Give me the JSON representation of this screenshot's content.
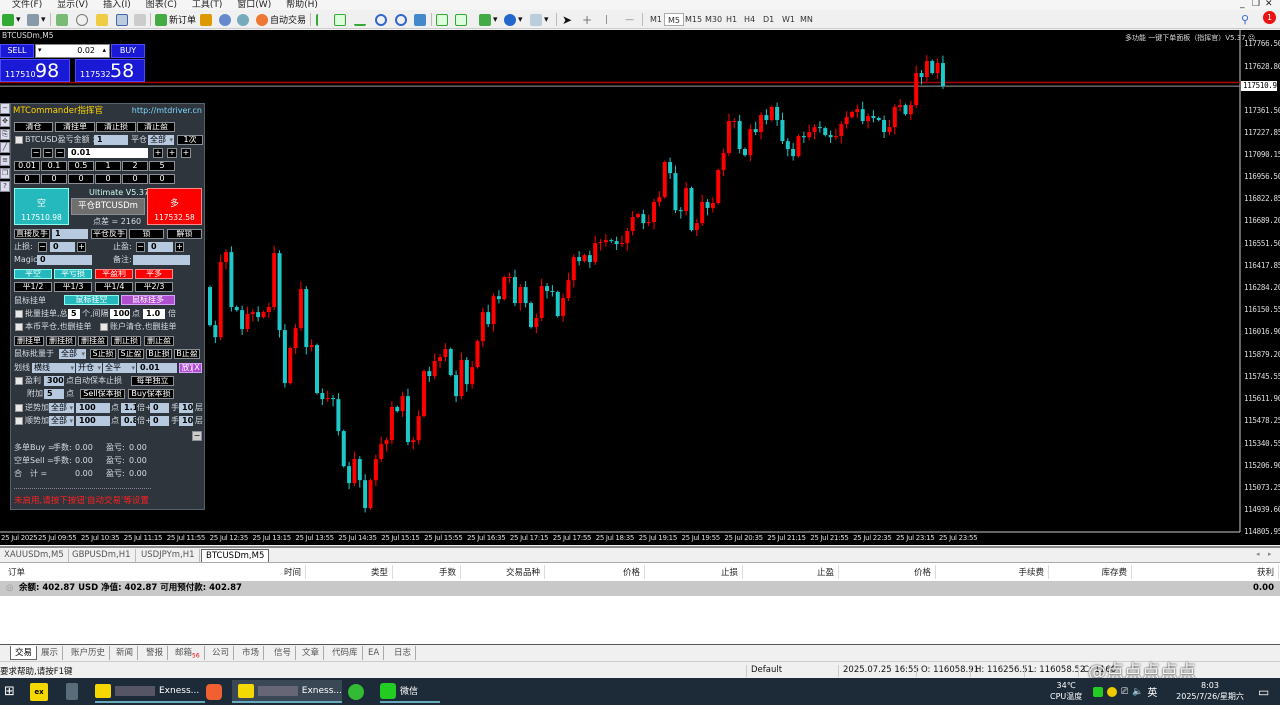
{
  "menu": [
    "文件(F)",
    "显示(V)",
    "插入(I)",
    "图表(C)",
    "工具(T)",
    "窗口(W)",
    "帮助(H)"
  ],
  "toolbar": {
    "new_order": "新订单",
    "auto_trading": "自动交易",
    "timeframes": [
      "M1",
      "M5",
      "M15",
      "M30",
      "H1",
      "H4",
      "D1",
      "W1",
      "MN"
    ],
    "active_tf": "M5",
    "notifications": "1"
  },
  "chart": {
    "title": "BTCUSDm,M5",
    "indicator_label": "多功能 一键下单面板（指挥官）V5.37",
    "bid": "117510.98"
  },
  "oneclick": {
    "sell": "SELL",
    "buy": "BUY",
    "lot": "0.02",
    "sell_big": "117510",
    "sell_pips": "98",
    "buy_big": "117532",
    "buy_pips": "58"
  },
  "panel": {
    "title": "MTCommander指挥官",
    "url": "http://mtdriver.cn",
    "row1": [
      "清仓",
      "清挂单",
      "清止损",
      "清止盈"
    ],
    "pl_label": "BTCUSD盈亏金额 >",
    "pl_value": "1",
    "close_label": "平仓",
    "close_sel": "全部",
    "times": "1次",
    "lot": "0.01",
    "lot_presets": [
      "0.01",
      "0.1",
      "0.5",
      "1",
      "2",
      "5"
    ],
    "zeros": [
      "0",
      "0",
      "0",
      "0",
      "0",
      "0"
    ],
    "sell_label": "空",
    "sell_price": "117510.98",
    "version": "Ultimate V5.37",
    "close_sym": "平仓BTCUSDm",
    "spread": "点差 = 2160",
    "buy_label": "多",
    "buy_price": "117532.58",
    "reverse": "直接反手",
    "reverse_val": "1",
    "close_reverse": "平仓反手",
    "lock": "锁",
    "unlock": "解锁",
    "sl_label": "止损:",
    "sl_val": "0",
    "tp_label": "止盈:",
    "tp_val": "0",
    "magic_label": "Magic:",
    "magic_val": "0",
    "comment_label": "备注:",
    "comment_val": "",
    "close_row": [
      "平空",
      "平亏损",
      "平盈利",
      "平多"
    ],
    "partial_row": [
      "平1/2",
      "平1/3",
      "平1/4",
      "平2/3"
    ],
    "mouse_pending": "鼠标挂单",
    "mouse_sell": "鼠标挂空",
    "mouse_buy": "鼠标挂多",
    "batch_label": "批量挂单,总",
    "batch_count": "5",
    "batch_unit": "个,间隔",
    "batch_gap": "100",
    "batch_pts": "点",
    "batch_mult": "1.0",
    "batch_x": "倍",
    "cb_sym": "本币平仓,也删挂单",
    "cb_acct": "账户清仓,也删挂单",
    "del_row": [
      "删挂单",
      "删挂损",
      "删挂盈",
      "删止损",
      "删止盈"
    ],
    "mouse_batch": "鼠标批量于",
    "mouse_batch_sel": "全部",
    "sb_row": [
      "S止损",
      "S止盈",
      "B止损",
      "B止盈"
    ],
    "line_label": "划线",
    "line_type": "横线",
    "line_open": "开仓",
    "line_close": "全平",
    "line_lot": "0.01",
    "place": "放置",
    "x": "X",
    "profit_label": "盈利",
    "profit_val": "300",
    "profit_text": "点自动保本止损",
    "each": "每单独立",
    "extra_label": "附加",
    "extra_val": "5",
    "extra_pts": "点",
    "sell_be": "Sell保本损",
    "buy_be": "Buy保本损",
    "counter_label": "逆势加",
    "counter_sel": "全部",
    "counter_pts": "100",
    "counter_mult": "1.1",
    "counter_add": "0",
    "counter_layers": "10",
    "trend_label": "顺势加",
    "trend_sel": "全部",
    "trend_pts": "100",
    "trend_mult": "0.8",
    "trend_add": "0",
    "trend_layers": "10",
    "pts": "点",
    "mult": "倍+",
    "hand": "手",
    "layer": "层",
    "buy_sum": "多单Buy =",
    "sell_sum": "空单Sell =",
    "total": "合　计 =",
    "lots_label": "手数:",
    "pl_lbl": "盈亏:",
    "zero": "0.00",
    "warning": "未启用,请按下按钮'自动交易'等设置"
  },
  "chart_data": {
    "type": "candlestick",
    "symbol": "BTCUSDm",
    "timeframe": "M5",
    "open_first": 116291,
    "closes": [
      116060,
      115987,
      116443,
      116503,
      116170,
      116151,
      116036,
      116127,
      116139,
      116109,
      116139,
      116170,
      116497,
      116030,
      115708,
      115921,
      116042,
      116279,
      115927,
      115939,
      115648,
      115611,
      115617,
      115611,
      115417,
      115204,
      115101,
      115247,
      115119,
      114950,
      115119,
      115247,
      115338,
      115362,
      115563,
      115538,
      115629,
      115350,
      115362,
      115508,
      115781,
      115751,
      115842,
      115866,
      115915,
      115757,
      115629,
      115848,
      115702,
      115805,
      115963,
      116139,
      116066,
      116236,
      116218,
      116352,
      116352,
      116194,
      116291,
      116194,
      116048,
      116103,
      116297,
      116267,
      116261,
      116115,
      116224,
      116333,
      116473,
      116449,
      116485,
      116443,
      116558,
      116564,
      116576,
      116570,
      116552,
      116558,
      116631,
      116716,
      116734,
      116679,
      116686,
      116807,
      116837,
      117050,
      116983,
      116758,
      116752,
      116892,
      116637,
      116679,
      116807,
      116771,
      116801,
      117001,
      117104,
      117299,
      117299,
      117129,
      117092,
      117250,
      117232,
      117335,
      117305,
      117384,
      117305,
      117177,
      117129,
      117086,
      117208,
      117201,
      117232,
      117262,
      117256,
      117214,
      117201,
      117208,
      117280,
      117323,
      117353,
      117371,
      117299,
      117329,
      117317,
      117305,
      117232,
      117262,
      117384,
      117396,
      117341,
      117396,
      117590,
      117566,
      117663,
      117590,
      117651,
      117511
    ],
    "ask": 117532.58,
    "bid": 117510.98,
    "ylim": [
      114805.95,
      117766.5
    ],
    "y_ticks": [
      "117766.50",
      "117628.80",
      "117361.50",
      "117227.85",
      "117090.15",
      "116956.50",
      "116822.85",
      "116689.20",
      "116551.50",
      "116417.85",
      "116284.20",
      "116150.55",
      "116016.90",
      "115879.20",
      "115745.55",
      "115611.90",
      "115478.25",
      "115340.55",
      "115206.90",
      "115073.25",
      "114939.60",
      "114805.95"
    ],
    "x_ticks": [
      "25 Jul 2025",
      "25 Jul 09:55",
      "25 Jul 10:35",
      "25 Jul 11:15",
      "25 Jul 11:55",
      "25 Jul 12:35",
      "25 Jul 13:15",
      "25 Jul 13:55",
      "25 Jul 14:35",
      "25 Jul 15:15",
      "25 Jul 15:55",
      "25 Jul 16:35",
      "25 Jul 17:15",
      "25 Jul 17:55",
      "25 Jul 18:35",
      "25 Jul 19:15",
      "25 Jul 19:55",
      "25 Jul 20:35",
      "25 Jul 21:15",
      "25 Jul 21:55",
      "25 Jul 22:35",
      "25 Jul 23:15",
      "25 Jul 23:55"
    ],
    "bull_color": "#ff0000",
    "bear_color": "#1ec8c8"
  },
  "symbol_tabs": [
    "XAUUSDm,M5",
    "GBPUSDm,H1",
    "USDJPYm,H1",
    "BTCUSDm,M5"
  ],
  "terminal": {
    "columns": [
      "订单",
      "时间",
      "类型",
      "手数",
      "交易品种",
      "价格",
      "止损",
      "止盈",
      "价格",
      "手续费",
      "库存费",
      "获利"
    ],
    "balance": "余额: 402.87 USD  净值: 402.87  可用预付款: 402.87",
    "profit": "0.00"
  },
  "terminal_tabs": [
    "交易",
    "展示",
    "账户历史",
    "新闻",
    "警报",
    "邮箱",
    "公司",
    "市场",
    "信号",
    "文章",
    "代码库",
    "EA",
    "日志"
  ],
  "mail_count": "56",
  "status": {
    "help": "要求帮助,请按F1键",
    "profile": "Default",
    "datetime": "2025.07.25 16:55",
    "open": "O: 116058.91",
    "high": "H: 116256.51",
    "low": "L: 116058.52",
    "close": "C: 1160",
    "watermark": "@点点点点点"
  },
  "taskbar": {
    "app1": "Exness...",
    "app2": "Exness...",
    "wechat": "微信",
    "temp": "34℃",
    "temp_label": "CPU温度",
    "ime": "英",
    "time": "8:03",
    "date": "2025/7/26/星期六"
  }
}
